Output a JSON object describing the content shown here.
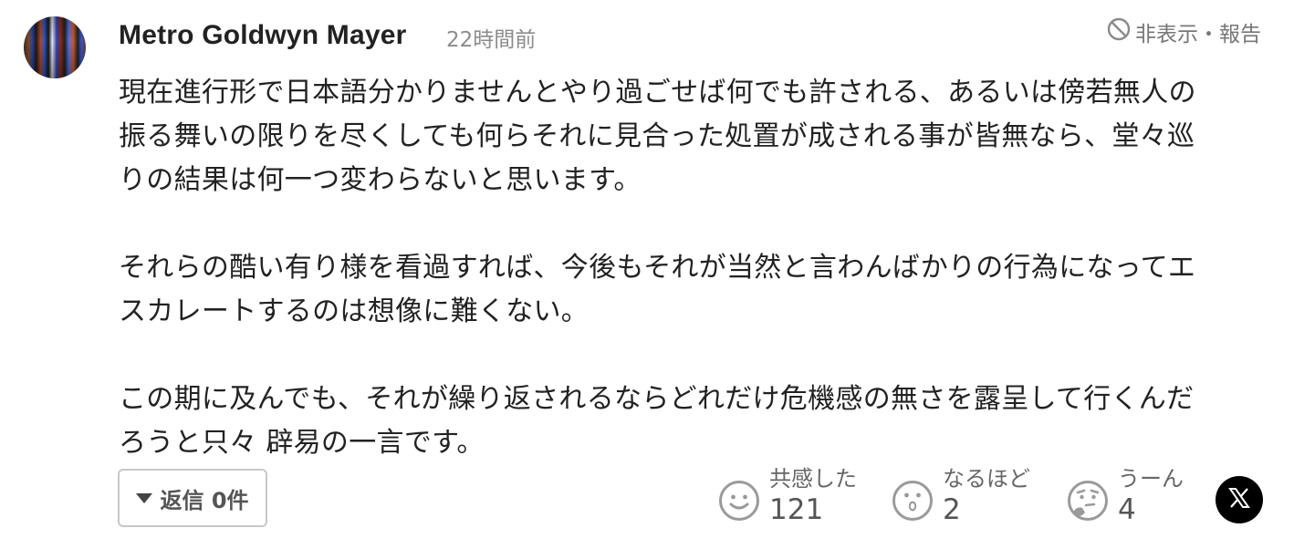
{
  "comment": {
    "author": "Metro Goldwyn Mayer",
    "time": "22時間前",
    "hide_report_label": "非表示・報告",
    "paragraphs": [
      "現在進行形で日本語分かりませんとやり過ごせば何でも許される、あるいは傍若無人の\n振る舞いの限りを尽くしても何らそれに見合った処置が成される事が皆無なら、堂々巡\nりの結果は何一つ変わらないと思います。",
      "それらの酷い有り様を看過すれば、今後もそれが当然と言わんばかりの行為になってエ\nスカレートするのは想像に難くない。",
      "この期に及んでも、それが繰り返されるならどれだけ危機感の無さを露呈して行くんだ\nろうと只々 辟易の一言です。"
    ]
  },
  "reply": {
    "label": "返信 0件"
  },
  "reactions": [
    {
      "icon": "smile-face-icon",
      "label": "共感した",
      "count": "121"
    },
    {
      "icon": "surprised-face-icon",
      "label": "なるほど",
      "count": "2"
    },
    {
      "icon": "thinking-face-icon",
      "label": "うーん",
      "count": "4"
    }
  ],
  "share": {
    "icon": "x-logo-icon"
  },
  "colors": {
    "text": "#222222",
    "muted": "#8c8c8c",
    "icon_gray": "#9a9a9a",
    "border": "#c7c7c7"
  }
}
